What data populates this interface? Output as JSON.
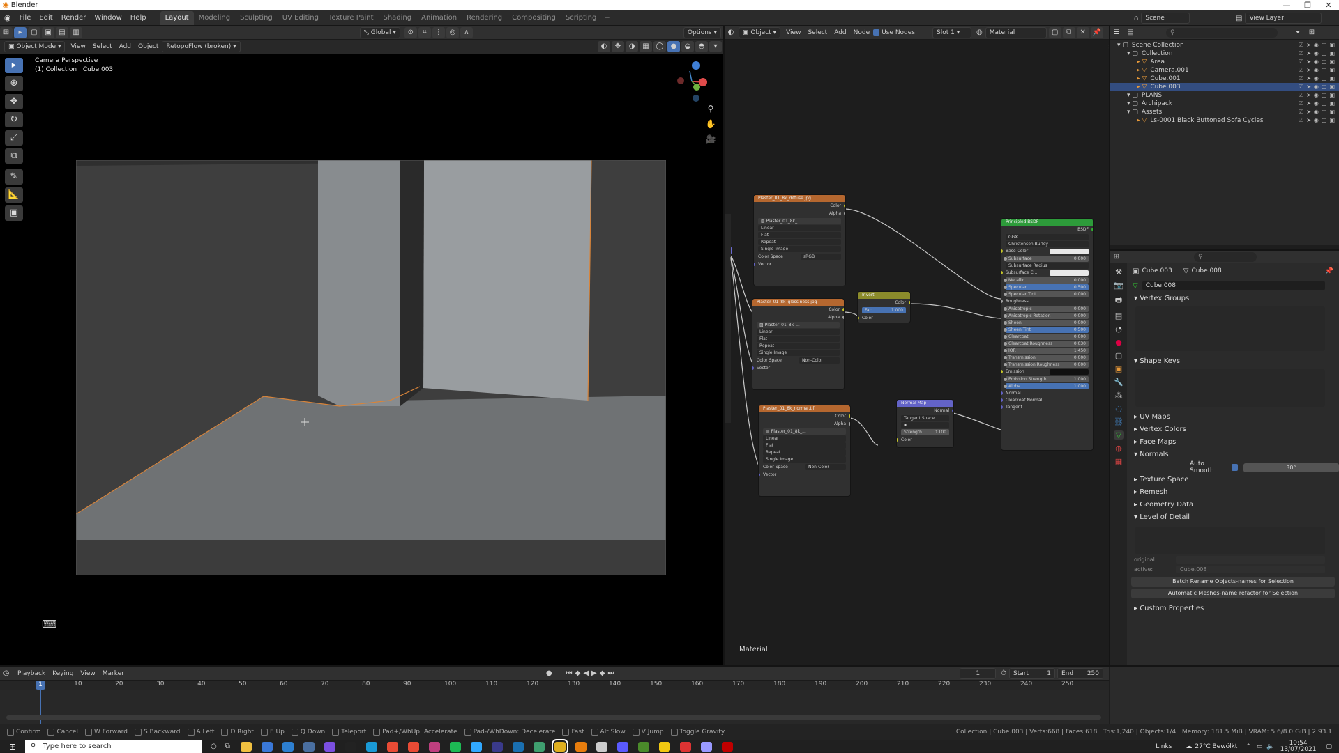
{
  "titlebar": {
    "title": "Blender"
  },
  "menu": [
    "File",
    "Edit",
    "Render",
    "Window",
    "Help"
  ],
  "workspaces": [
    "Layout",
    "Modeling",
    "Sculpting",
    "UV Editing",
    "Texture Paint",
    "Shading",
    "Animation",
    "Rendering",
    "Compositing",
    "Scripting"
  ],
  "active_workspace": "Layout",
  "scene_label": "Scene",
  "viewlayer_label": "View Layer",
  "viewport": {
    "mode": "Object Mode",
    "menus": [
      "View",
      "Select",
      "Add",
      "Object"
    ],
    "addon": "RetopoFlow (broken)",
    "orientation": "Global",
    "options": "Options",
    "overlay_title": "Camera Perspective",
    "overlay_sub": "(1) Collection | Cube.003"
  },
  "node_editor": {
    "type": "Object",
    "menus": [
      "View",
      "Select",
      "Add",
      "Node"
    ],
    "use_nodes": "Use Nodes",
    "slot": "Slot 1",
    "material": "Material",
    "footer": "Material",
    "nodes": {
      "diffuse": {
        "title": "Plaster_01_8k_diffuse.jpg",
        "out_color": "Color",
        "out_alpha": "Alpha",
        "image": "Plaster_01_8k_...",
        "interp": "Linear",
        "proj": "Flat",
        "ext": "Repeat",
        "src": "Single Image",
        "cs_label": "Color Space",
        "cs": "sRGB",
        "vector": "Vector"
      },
      "gloss": {
        "title": "Plaster_01_8k_glossiness.jpg",
        "out_color": "Color",
        "out_alpha": "Alpha",
        "image": "Plaster_01_8k_...",
        "interp": "Linear",
        "proj": "Flat",
        "ext": "Repeat",
        "src": "Single Image",
        "cs_label": "Color Space",
        "cs": "Non-Color",
        "vector": "Vector"
      },
      "normal": {
        "title": "Plaster_01_8k_normal.tif",
        "out_color": "Color",
        "out_alpha": "Alpha",
        "image": "Plaster_01_8k_...",
        "interp": "Linear",
        "proj": "Flat",
        "ext": "Repeat",
        "src": "Single Image",
        "cs_label": "Color Space",
        "cs": "Non-Color",
        "vector": "Vector"
      },
      "invert": {
        "title": "Invert",
        "out": "Color",
        "fac_label": "Fac",
        "fac": "1.000",
        "in": "Color"
      },
      "normalmap": {
        "title": "Normal Map",
        "out": "Normal",
        "space": "Tangent Space",
        "strength_label": "Strength",
        "strength": "0.100",
        "in": "Color"
      },
      "bsdf": {
        "title": "Principled BSDF",
        "out": "BSDF",
        "dist": "GGX",
        "sss": "Christensen-Burley",
        "rows": [
          {
            "label": "Base Color",
            "value": "",
            "kind": "swatch"
          },
          {
            "label": "Subsurface",
            "value": "0.000",
            "kind": "val"
          },
          {
            "label": "Subsurface Radius",
            "value": "",
            "kind": "sel"
          },
          {
            "label": "Subsurface C...",
            "value": "",
            "kind": "swatch"
          },
          {
            "label": "Metallic",
            "value": "0.000",
            "kind": "val"
          },
          {
            "label": "Specular",
            "value": "0.500",
            "kind": "blue"
          },
          {
            "label": "Specular Tint",
            "value": "0.000",
            "kind": "val"
          },
          {
            "label": "Roughness",
            "value": "",
            "kind": "plain"
          },
          {
            "label": "Anisotropic",
            "value": "0.000",
            "kind": "val"
          },
          {
            "label": "Anisotropic Rotation",
            "value": "0.000",
            "kind": "val"
          },
          {
            "label": "Sheen",
            "value": "0.000",
            "kind": "val"
          },
          {
            "label": "Sheen Tint",
            "value": "0.500",
            "kind": "blue"
          },
          {
            "label": "Clearcoat",
            "value": "0.000",
            "kind": "val"
          },
          {
            "label": "Clearcoat Roughness",
            "value": "0.030",
            "kind": "val"
          },
          {
            "label": "IOR",
            "value": "1.450",
            "kind": "val"
          },
          {
            "label": "Transmission",
            "value": "0.000",
            "kind": "val"
          },
          {
            "label": "Transmission Roughness",
            "value": "0.000",
            "kind": "val"
          },
          {
            "label": "Emission",
            "value": "",
            "kind": "dark"
          },
          {
            "label": "Emission Strength",
            "value": "1.000",
            "kind": "val"
          },
          {
            "label": "Alpha",
            "value": "1.000",
            "kind": "blue"
          },
          {
            "label": "Normal",
            "value": "",
            "kind": "plain"
          },
          {
            "label": "Clearcoat Normal",
            "value": "",
            "kind": "plain"
          },
          {
            "label": "Tangent",
            "value": "",
            "kind": "plain"
          }
        ]
      }
    }
  },
  "outliner": {
    "rows": [
      {
        "label": "Scene Collection",
        "indent": 0,
        "sel": false
      },
      {
        "label": "Collection",
        "indent": 1,
        "sel": false
      },
      {
        "label": "Area",
        "indent": 2,
        "sel": false
      },
      {
        "label": "Camera.001",
        "indent": 2,
        "sel": false
      },
      {
        "label": "Cube.001",
        "indent": 2,
        "sel": false
      },
      {
        "label": "Cube.003",
        "indent": 2,
        "sel": true
      },
      {
        "label": "PLANS",
        "indent": 1,
        "sel": false
      },
      {
        "label": "Archipack",
        "indent": 1,
        "sel": false
      },
      {
        "label": "Assets",
        "indent": 1,
        "sel": false
      },
      {
        "label": "Ls-0001 Black Buttoned Sofa Cycles",
        "indent": 2,
        "sel": false
      }
    ]
  },
  "properties": {
    "object": "Cube.003",
    "mesh": "Cube.008",
    "datablock": "Cube.008",
    "vertex_groups": "Vertex Groups",
    "shape_keys": "Shape Keys",
    "sections": [
      "UV Maps",
      "Vertex Colors",
      "Face Maps",
      "Normals"
    ],
    "auto_smooth": "Auto Smooth",
    "angle": "30°",
    "sections2": [
      "Texture Space",
      "Remesh",
      "Geometry Data",
      "Level of Detail"
    ],
    "original_label": "original:",
    "active_label": "active:",
    "active_val": "Cube.008",
    "btn1": "Batch Rename Objects-names for Selection",
    "btn2": "Automatic Meshes-name refactor for Selection",
    "custom": "Custom Properties"
  },
  "timeline": {
    "menus": [
      "Playback",
      "Keying",
      "View",
      "Marker"
    ],
    "frame": "1",
    "start_label": "Start",
    "start": "1",
    "end_label": "End",
    "end": "250",
    "ticks": [
      "1",
      "10",
      "20",
      "30",
      "40",
      "50",
      "60",
      "70",
      "80",
      "90",
      "100",
      "110",
      "120",
      "130",
      "140",
      "150",
      "160",
      "170",
      "180",
      "190",
      "200",
      "210",
      "220",
      "230",
      "240",
      "250"
    ]
  },
  "statusbar": {
    "items": [
      "Confirm",
      "Cancel",
      "W Forward",
      "S Backward",
      "A Left",
      "D Right",
      "E Up",
      "Q Down",
      "Teleport",
      "Pad+/WhUp: Accelerate",
      "Pad-/WhDown: Decelerate",
      "Fast",
      "Alt Slow",
      "V Jump",
      "Toggle Gravity"
    ],
    "right": "Collection | Cube.003 | Verts:668 | Faces:618 | Tris:1,240 | Objects:1/4 | Memory: 181.5 MiB | VRAM: 5.6/8.0 GiB | 2.93.1"
  },
  "taskbar": {
    "search_placeholder": "Type here to search",
    "links": "Links",
    "weather": "27°C  Bewölkt",
    "time": "10:54",
    "date": "13/07/2021",
    "app_colors": [
      "#f0c040",
      "#3a78d8",
      "#2d7fd0",
      "#4a6fa0",
      "#7b4fe0",
      "#222",
      "#1a9ad6",
      "#e94b35",
      "#e94b35",
      "#bf3f7f",
      "#1db954",
      "#31a8ff",
      "#3a3a8a",
      "#1a6fb0",
      "#3f9f6f",
      "#e0b020",
      "#e87d0d",
      "#cccccc",
      "#5a5aff",
      "#4a8a2a",
      "#f2c811",
      "#d33",
      "#9999ff",
      "#c00000"
    ]
  }
}
